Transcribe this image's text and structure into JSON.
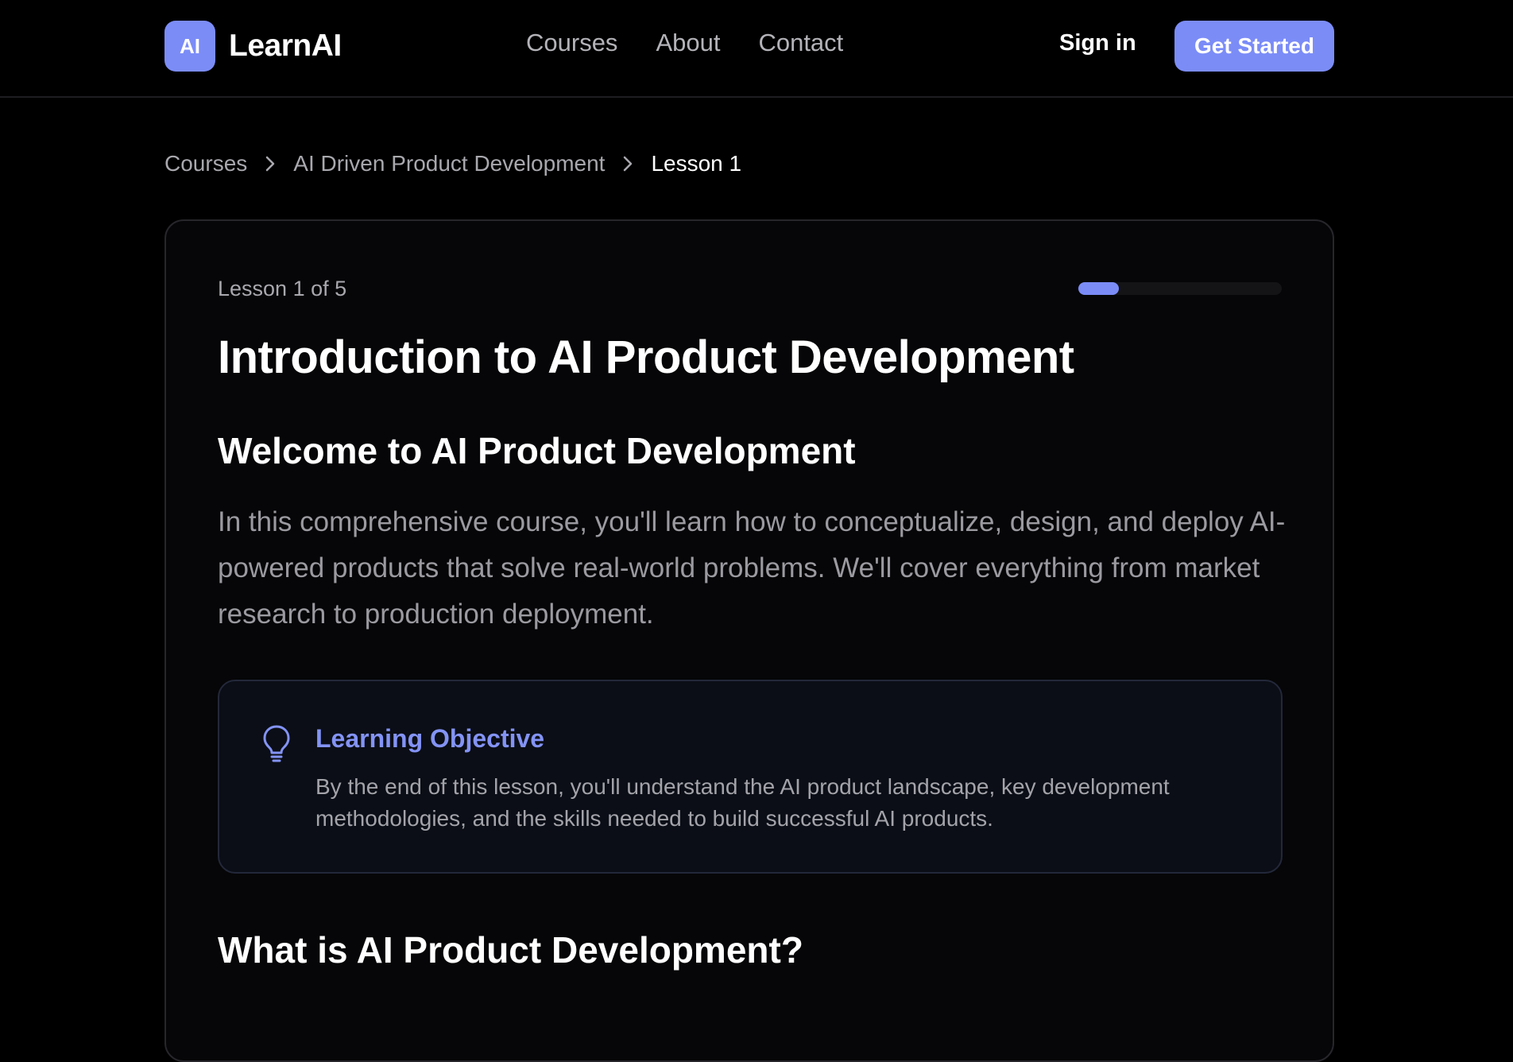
{
  "colors": {
    "accent": "#7b8cf7",
    "objective_title": "#8393f5",
    "background": "#000000",
    "card_background": "#060608"
  },
  "nav": {
    "logo_badge": "AI",
    "logo_text": "LearnAI",
    "links": [
      "Courses",
      "About",
      "Contact"
    ],
    "sign_in": "Sign in",
    "get_started": "Get Started"
  },
  "breadcrumb": {
    "items": [
      "Courses",
      "AI Driven Product Development",
      "Lesson 1"
    ],
    "separator_icon": "chevron-right-icon"
  },
  "lesson": {
    "count_label": "Lesson 1 of 5",
    "progress_fraction": 0.2,
    "title": "Introduction to AI Product Development",
    "section_heading": "Welcome to AI Product Development",
    "intro_text": "In this comprehensive course, you'll learn how to conceptualize, design, and deploy AI-powered products that solve real-world problems. We'll cover everything from market research to production deployment.",
    "objective": {
      "icon": "lightbulb-icon",
      "title": "Learning Objective",
      "text": "By the end of this lesson, you'll understand the AI product landscape, key development methodologies, and the skills needed to build successful AI products."
    },
    "next_heading": "What is AI Product Development?"
  }
}
